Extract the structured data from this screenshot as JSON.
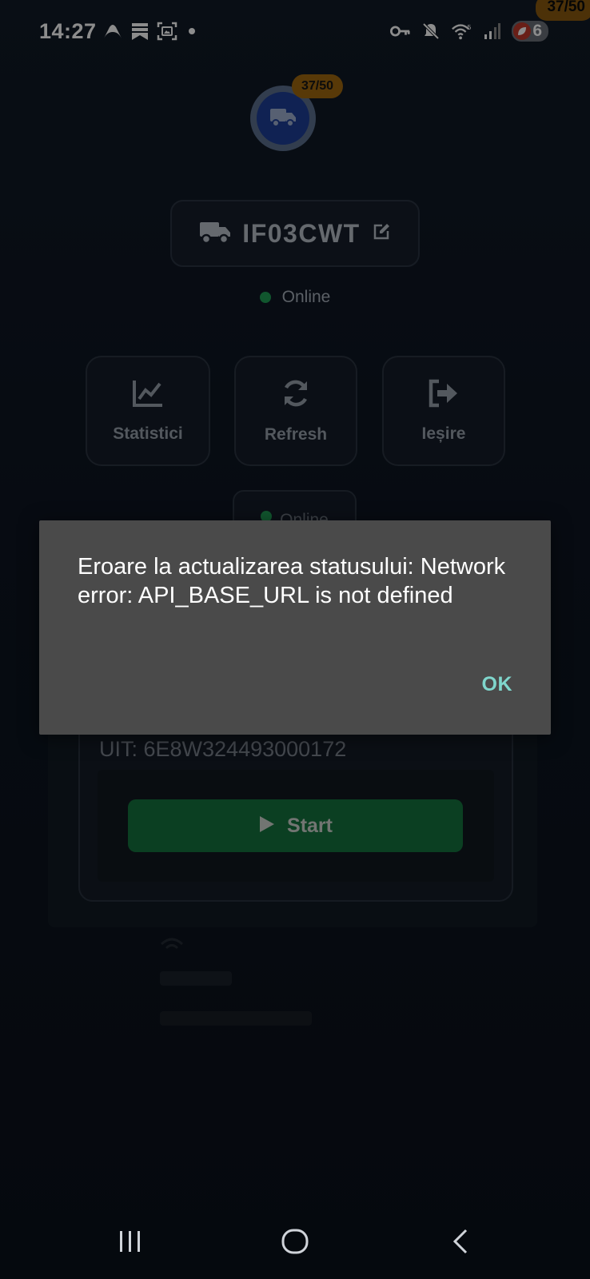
{
  "status_bar": {
    "time": "14:27",
    "battery_level": "6",
    "corner_badge": "37/50",
    "left_icons": [
      "app-notification-icon",
      "bookmark-icon",
      "screenshot-icon",
      "dot-icon"
    ],
    "right_icons": [
      "vpn-key-icon",
      "mute-icon",
      "wifi-icon",
      "signal-icon",
      "battery-saver-icon"
    ]
  },
  "header": {
    "avatar_badge": "37/50",
    "avatar_icon": "truck-icon",
    "plate": "IF03CWT",
    "plate_icons": [
      "truck-icon",
      "edit-icon"
    ],
    "status": "Online"
  },
  "actions": [
    {
      "label": "Statistici",
      "icon": "chart-line-icon"
    },
    {
      "label": "Refresh",
      "icon": "refresh-icon"
    },
    {
      "label": "Ieșire",
      "icon": "sign-out-icon"
    }
  ],
  "status_chip": {
    "label": "Online"
  },
  "trip_card": {
    "uit": "UIT: 6E8W324493000172",
    "start_label": "Start"
  },
  "dialog": {
    "message": "Eroare la actualizarea statusului: Network error: API_BASE_URL is not defined",
    "ok_label": "OK"
  },
  "colors": {
    "accent_online": "#1f9d55",
    "start_button": "#15733e",
    "badge": "#a06910",
    "dialog_bg": "#4a4a4a",
    "dialog_ok": "#7fd6cc"
  },
  "nav_bar": {
    "buttons": [
      "recents-icon",
      "home-icon",
      "back-icon"
    ]
  }
}
